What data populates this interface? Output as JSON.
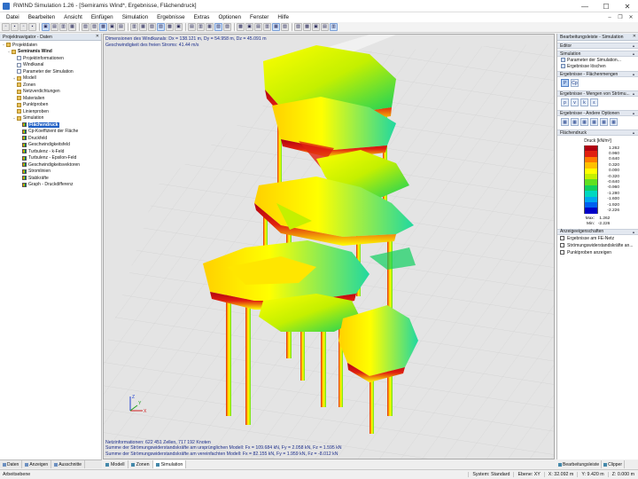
{
  "window": {
    "title": "RWIND Simulation 1.26 - [Semiramis Wind*, Ergebnisse, Flächendruck]",
    "min": "—",
    "max": "☐",
    "close": "✕"
  },
  "menu": [
    "Datei",
    "Bearbeiten",
    "Ansicht",
    "Einfügen",
    "Simulation",
    "Ergebnisse",
    "Extras",
    "Optionen",
    "Fenster",
    "Hilfe"
  ],
  "navigator": {
    "title": "Projektnavigator - Daten",
    "items": [
      {
        "label": "Projektdaten",
        "level": 0,
        "icon": "folder",
        "exp": "−"
      },
      {
        "label": "Semiramis Wind",
        "level": 1,
        "icon": "folder",
        "exp": "−",
        "bold": true
      },
      {
        "label": "Projektinformationen",
        "level": 2,
        "icon": "doc"
      },
      {
        "label": "Windkanal",
        "level": 2,
        "icon": "doc"
      },
      {
        "label": "Parameter der Simulation",
        "level": 2,
        "icon": "doc"
      },
      {
        "label": "Modell",
        "level": 2,
        "icon": "folder",
        "exp": "+"
      },
      {
        "label": "Zonen",
        "level": 2,
        "icon": "folder"
      },
      {
        "label": "Netzverdichtungen",
        "level": 2,
        "icon": "folder"
      },
      {
        "label": "Materialien",
        "level": 2,
        "icon": "folder"
      },
      {
        "label": "Punktproben",
        "level": 2,
        "icon": "folder"
      },
      {
        "label": "Linienproben",
        "level": 2,
        "icon": "folder"
      },
      {
        "label": "Simulation",
        "level": 2,
        "icon": "folder",
        "exp": "−"
      },
      {
        "label": "Flächendruck",
        "level": 3,
        "icon": "res",
        "selected": true
      },
      {
        "label": "Cp-Koeffizient der Fläche",
        "level": 3,
        "icon": "res"
      },
      {
        "label": "Druckfeld",
        "level": 3,
        "icon": "res"
      },
      {
        "label": "Geschwindigkeitsfeld",
        "level": 3,
        "icon": "res"
      },
      {
        "label": "Turbulenz - k-Feld",
        "level": 3,
        "icon": "res"
      },
      {
        "label": "Turbulenz - Epsilon-Feld",
        "level": 3,
        "icon": "res"
      },
      {
        "label": "Geschwindigkeitsvektoren",
        "level": 3,
        "icon": "res"
      },
      {
        "label": "Stromlinien",
        "level": 3,
        "icon": "res"
      },
      {
        "label": "Stabkräfte",
        "level": 3,
        "icon": "res"
      },
      {
        "label": "Graph - Druckdifferenz",
        "level": 3,
        "icon": "res"
      }
    ],
    "tabs": [
      "Daten",
      "Anzeigen",
      "Ausschnitte"
    ]
  },
  "viewport": {
    "info1": "Dimensionen des Windkanals: Dx = 138.121 m, Dy = 54.958 m, Dz = 45.091 m",
    "info2": "Geschwindigkeit des freien Stroms: 41.44 m/s",
    "foot1": "Netzinformationen: 622 451 Zellen, 717 192 Knoten",
    "foot2": "Summe der Strömungswiderstandskräfte am ursprünglichen Modell: Fx = 109.684 kN, Fy = 2.058 kN, Fz = 1.595 kN",
    "foot3": "Summe der Strömungswiderstandskräfte am vereinfachten Modell: Fx = 82.155 kN, Fy = 1.959 kN, Fz = -8.012 kN",
    "tabs": [
      "Modell",
      "Zonen",
      "Simulation"
    ],
    "axes": {
      "x": "X",
      "y": "Y",
      "z": "Z"
    }
  },
  "rightpanel": {
    "title": "Bearbeitungsleiste - Simulation",
    "editor": "Editor",
    "simulation": "Simulation",
    "sim_items": [
      "Parameter der Simulation...",
      "Ergebnisse löschen"
    ],
    "flaechen": "Ergebnisse - Flächenmengen",
    "flaechen_icons": [
      "P",
      "Cp"
    ],
    "mengen": "Ergebnisse - Mengen von Strömu...",
    "mengen_icons": [
      "p",
      "v",
      "k",
      "ε"
    ],
    "andere": "Ergebnisse - Andere Optionen",
    "flaechendruck": "Flächendruck",
    "legend_title": "Druck [kN/m²]",
    "legend": [
      {
        "v": "1.262",
        "c": "#b00010"
      },
      {
        "v": "0.960",
        "c": "#e02010"
      },
      {
        "v": "0.640",
        "c": "#ff7a00"
      },
      {
        "v": "0.320",
        "c": "#ffc000"
      },
      {
        "v": "0.000",
        "c": "#ffff00"
      },
      {
        "v": "-0.320",
        "c": "#c4f000"
      },
      {
        "v": "-0.640",
        "c": "#60e020"
      },
      {
        "v": "-0.960",
        "c": "#10d060"
      },
      {
        "v": "-1.280",
        "c": "#00d8c0"
      },
      {
        "v": "-1.600",
        "c": "#00a8f0"
      },
      {
        "v": "-1.920",
        "c": "#0060f0"
      },
      {
        "v": "-2.226",
        "c": "#0000c8"
      }
    ],
    "max_label": "Max:",
    "max": "1.262",
    "min_label": "Min:",
    "min": "-2.226",
    "anzeige": "Anzeigeeigenschaften",
    "checks": [
      "Ergebnisse am FE-Netz",
      "Strömungswiderstandskräfte an...",
      "Punktproben anzeigen"
    ],
    "tabs": [
      "Bearbeitungsleiste",
      "Clipper"
    ]
  },
  "status": {
    "left": "Arbeitsebene",
    "system": "System: Standard",
    "plane": "Ebene: XY",
    "x": "X: 32.092 m",
    "y": "Y: 9.420 m",
    "z": "Z: 0.000 m"
  }
}
